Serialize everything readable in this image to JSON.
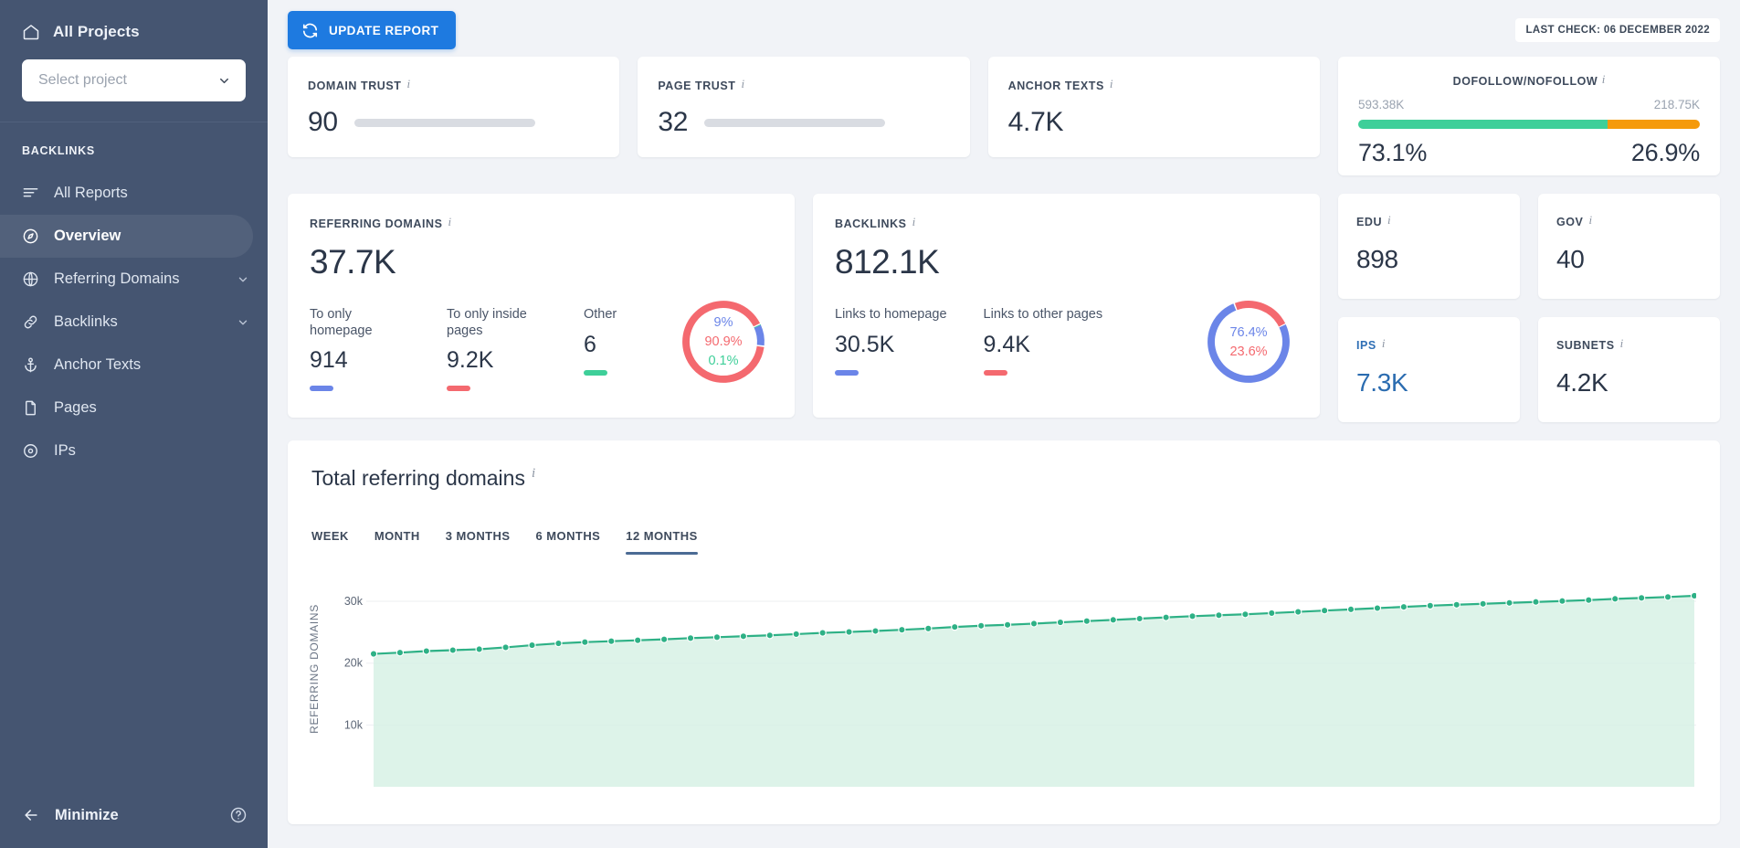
{
  "sidebar": {
    "all_projects": "All Projects",
    "project_select_placeholder": "Select project",
    "section_title": "BACKLINKS",
    "items": [
      {
        "label": "All Reports",
        "icon": "list-icon",
        "active": false,
        "chevron": false
      },
      {
        "label": "Overview",
        "icon": "compass-icon",
        "active": true,
        "chevron": false
      },
      {
        "label": "Referring Domains",
        "icon": "globe-icon",
        "active": false,
        "chevron": true
      },
      {
        "label": "Backlinks",
        "icon": "link-icon",
        "active": false,
        "chevron": true
      },
      {
        "label": "Anchor Texts",
        "icon": "anchor-icon",
        "active": false,
        "chevron": false
      },
      {
        "label": "Pages",
        "icon": "page-icon",
        "active": false,
        "chevron": false
      },
      {
        "label": "IPs",
        "icon": "target-icon",
        "active": false,
        "chevron": false
      }
    ],
    "minimize": "Minimize"
  },
  "topbar": {
    "update_report": "UPDATE REPORT",
    "last_check": "LAST CHECK: 06 DECEMBER 2022"
  },
  "kpis": [
    {
      "label": "DOMAIN TRUST",
      "value": "90",
      "percent": 90,
      "color": "#14a0e0"
    },
    {
      "label": "PAGE TRUST",
      "value": "32",
      "percent": 32,
      "color": "#c044d6"
    },
    {
      "label": "ANCHOR TEXTS",
      "value": "4.7K",
      "percent": null,
      "color": ""
    }
  ],
  "dofollow": {
    "label": "DOFOLLOW/NOFOLLOW",
    "left_count": "593.38K",
    "right_count": "218.75K",
    "left_pct": "73.1%",
    "right_pct": "26.9%",
    "left_pct_num": 73.1,
    "right_pct_num": 26.9,
    "left_color": "#3ecf99",
    "right_color": "#f59a0b"
  },
  "referring_domains": {
    "label": "REFERRING DOMAINS",
    "value": "37.7K",
    "segments": [
      {
        "label": "To only homepage",
        "value": "914",
        "color": "#6b85e8",
        "pct": "9%",
        "pct_num": 9.0
      },
      {
        "label": "To only inside pages",
        "value": "9.2K",
        "color": "#f4696f",
        "pct": "90.9%",
        "pct_num": 90.9
      },
      {
        "label": "Other",
        "value": "6",
        "color": "#3ecf99",
        "pct": "0.1%",
        "pct_num": 0.1
      }
    ]
  },
  "backlinks": {
    "label": "BACKLINKS",
    "value": "812.1K",
    "segments": [
      {
        "label": "Links to homepage",
        "value": "30.5K",
        "color": "#6b85e8",
        "pct": "76.4%",
        "pct_num": 76.4
      },
      {
        "label": "Links to other pages",
        "value": "9.4K",
        "color": "#f4696f",
        "pct": "23.6%",
        "pct_num": 23.6
      }
    ]
  },
  "mini_cards": [
    {
      "label": "EDU",
      "value": "898",
      "highlight": false
    },
    {
      "label": "GOV",
      "value": "40",
      "highlight": false
    },
    {
      "label": "IPS",
      "value": "7.3K",
      "highlight": true
    },
    {
      "label": "SUBNETS",
      "value": "4.2K",
      "highlight": false
    }
  ],
  "chart_panel": {
    "title": "Total referring domains",
    "tabs": [
      {
        "label": "WEEK",
        "active": false
      },
      {
        "label": "MONTH",
        "active": false
      },
      {
        "label": "3 MONTHS",
        "active": false
      },
      {
        "label": "6 MONTHS",
        "active": false
      },
      {
        "label": "12 MONTHS",
        "active": true
      }
    ]
  },
  "chart_data": {
    "type": "area",
    "title": "Total referring domains",
    "xlabel": "",
    "ylabel": "REFERRING DOMAINS",
    "ytick_labels": [
      "10k",
      "20k",
      "30k"
    ],
    "ytick_values": [
      10000,
      20000,
      30000
    ],
    "ylim": [
      0,
      34000
    ],
    "grid": true,
    "legend": "none",
    "line_color": "#2eb186",
    "fill_color": "#d6f0e4",
    "series": [
      {
        "name": "Referring domains",
        "values": [
          21500,
          21700,
          21950,
          22100,
          22250,
          22550,
          22900,
          23200,
          23400,
          23550,
          23700,
          23850,
          24050,
          24200,
          24350,
          24500,
          24700,
          24900,
          25050,
          25200,
          25400,
          25600,
          25850,
          26050,
          26200,
          26400,
          26600,
          26800,
          27000,
          27200,
          27400,
          27600,
          27750,
          27900,
          28100,
          28300,
          28500,
          28700,
          28900,
          29100,
          29300,
          29450,
          29600,
          29750,
          29900,
          30050,
          30200,
          30400,
          30550,
          30700,
          30900
        ]
      }
    ]
  }
}
